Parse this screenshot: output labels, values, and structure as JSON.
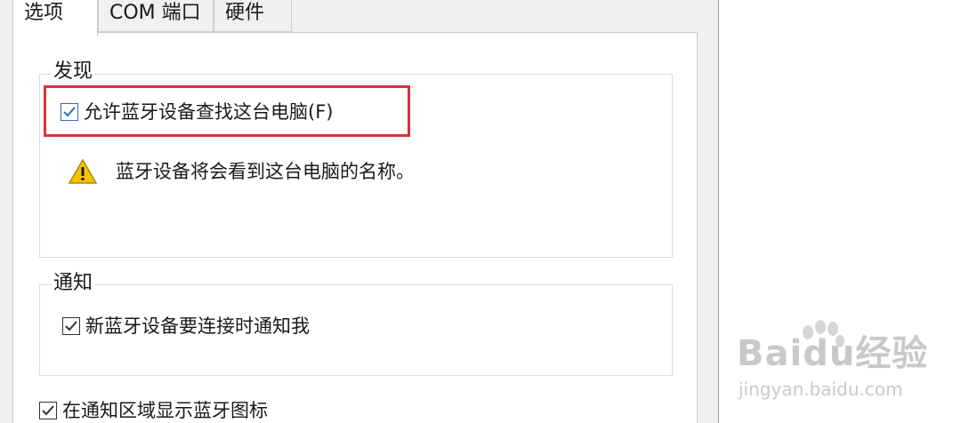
{
  "tabs": [
    {
      "label": "选项",
      "active": true
    },
    {
      "label": "COM 端口",
      "active": false
    },
    {
      "label": "硬件",
      "active": false
    }
  ],
  "discovery": {
    "group_label": "发现",
    "allow_find_label": "允许蓝牙设备查找这台电脑(F)",
    "allow_find_checked": true,
    "warning_text": "蓝牙设备将会看到这台电脑的名称。",
    "warning_icon": "warning-icon"
  },
  "notifications": {
    "group_label": "通知",
    "notify_label": "新蓝牙设备要连接时通知我",
    "notify_checked": true
  },
  "show_icon": {
    "label": "在通知区域显示蓝牙图标",
    "checked": true
  },
  "watermark": {
    "logo": "Baidu经验",
    "url": "jingyan.baidu.com"
  },
  "colors": {
    "highlight": "#d9323a",
    "warning_fill": "#f4c400",
    "watermark": "#c9c9c9"
  }
}
